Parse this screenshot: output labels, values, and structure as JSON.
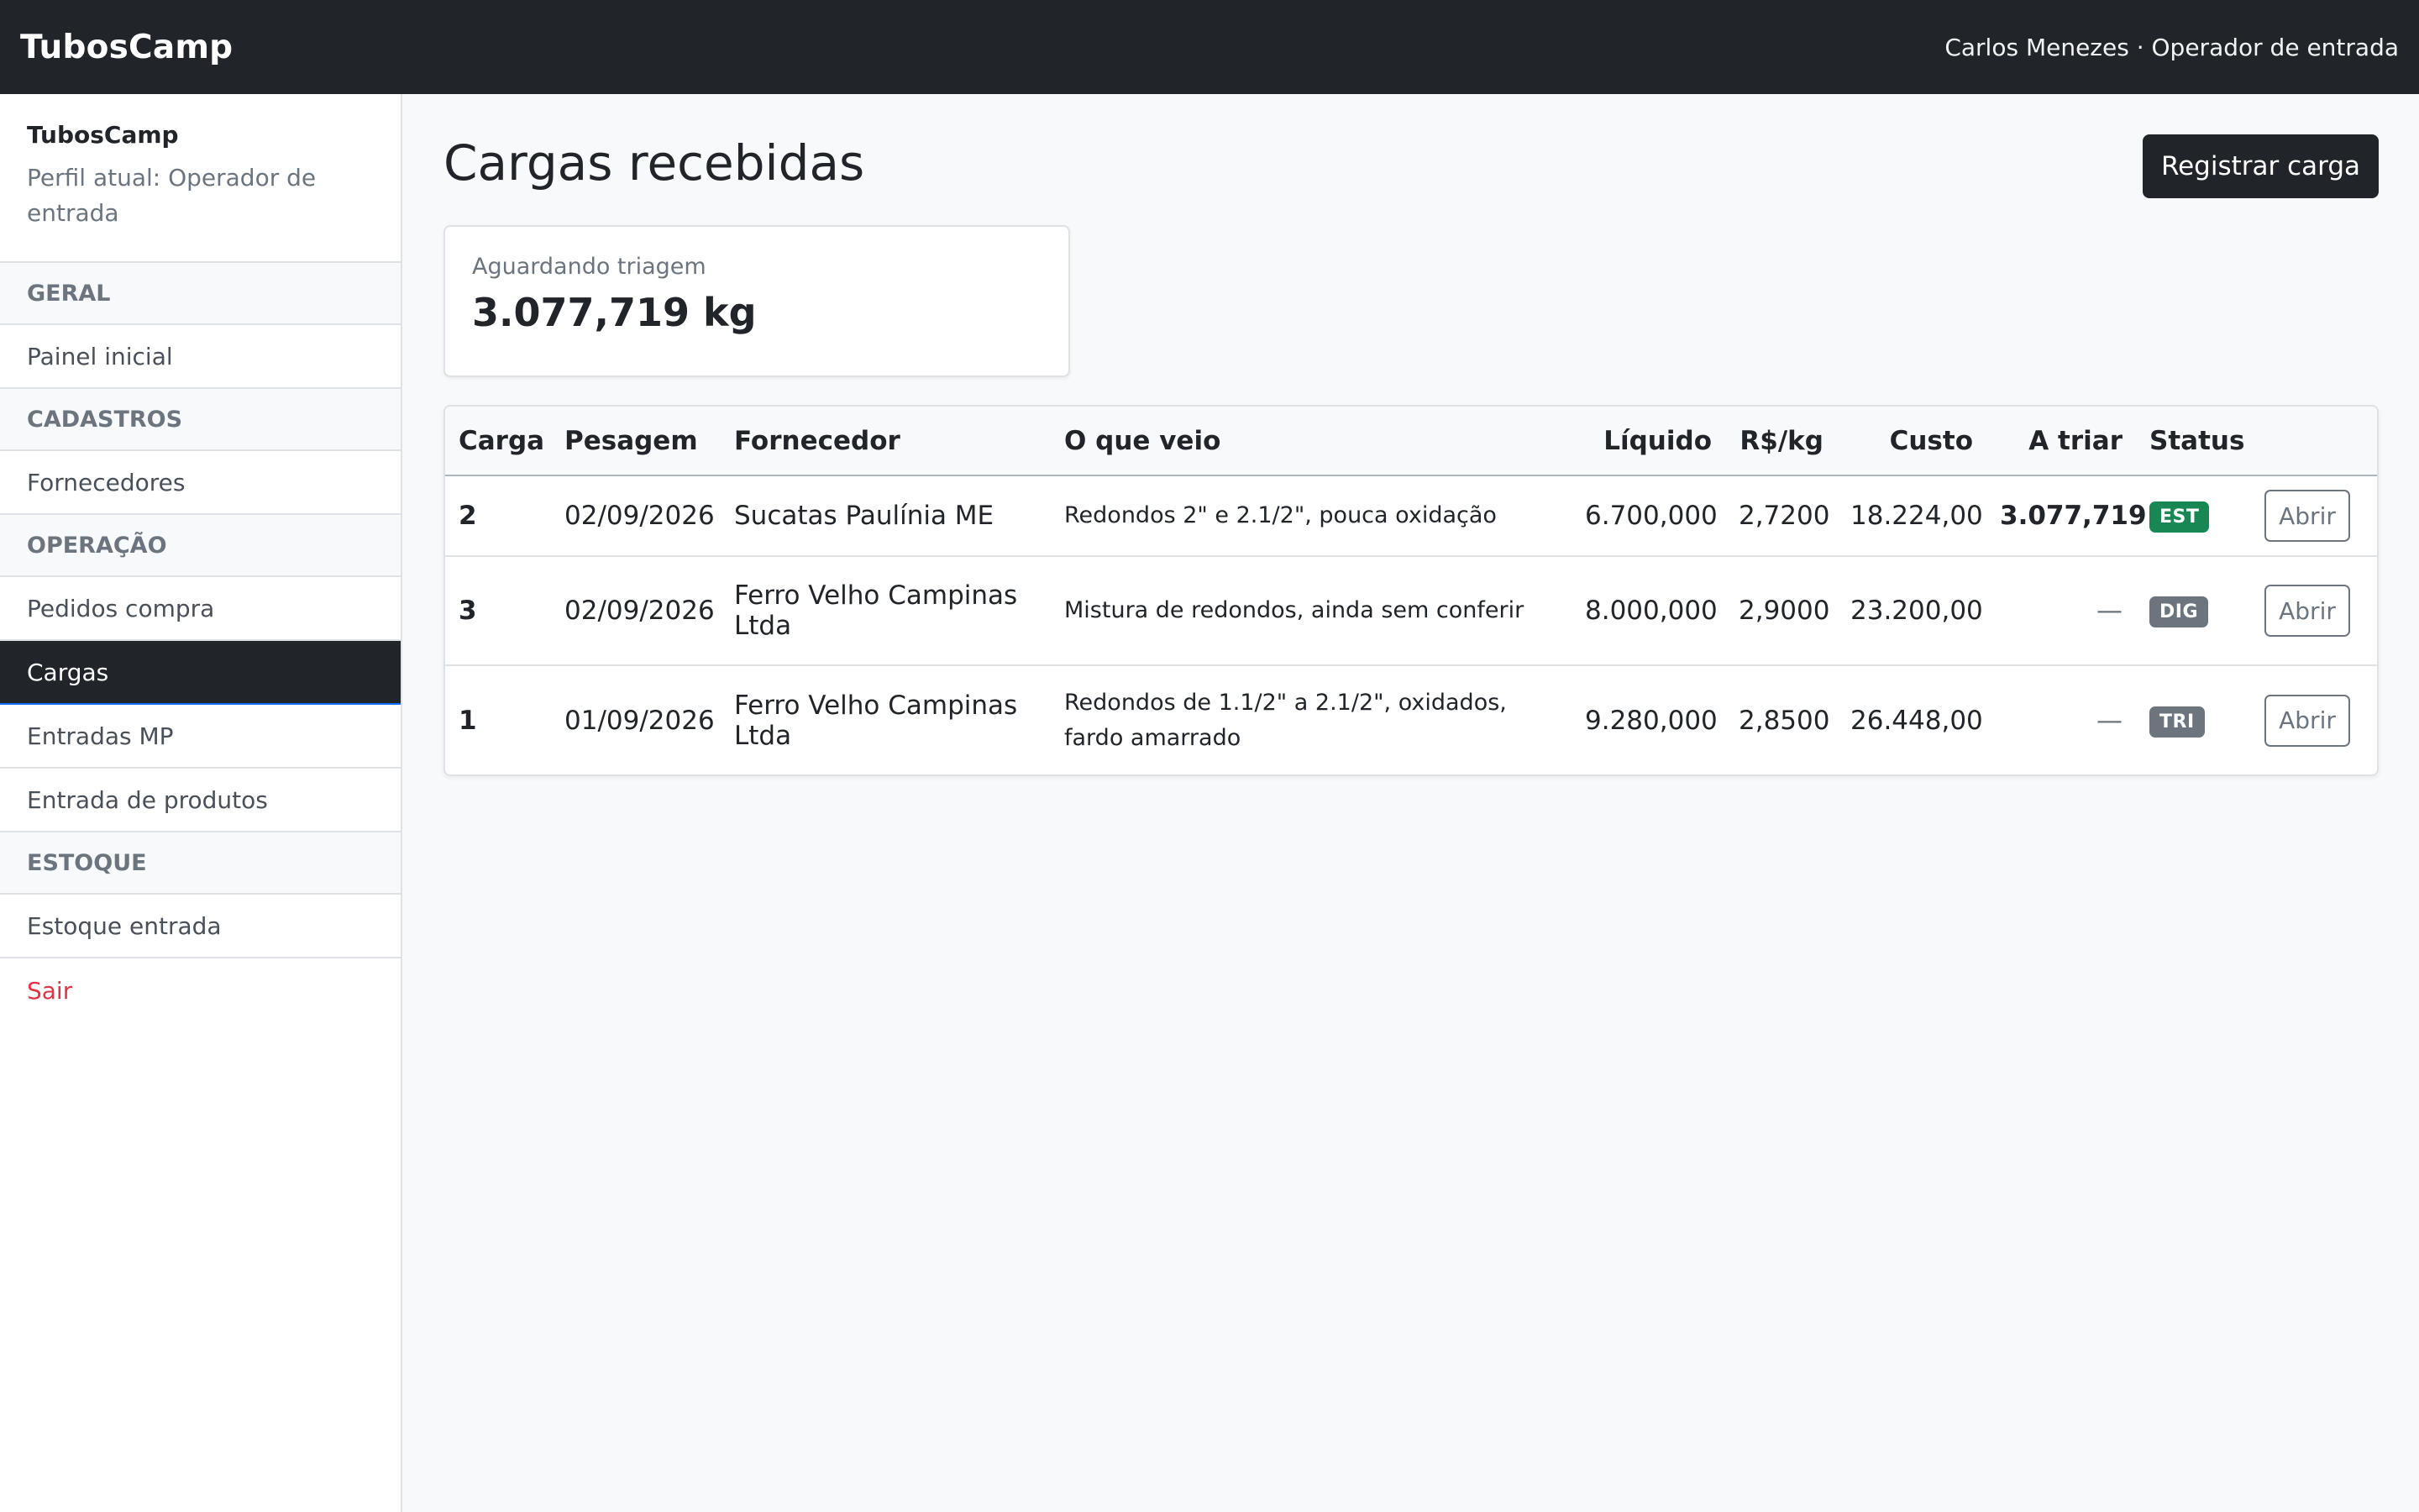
{
  "navbar": {
    "brand": "TubosCamp",
    "user": "Carlos Menezes · Operador de entrada"
  },
  "sidebar": {
    "app_name": "TubosCamp",
    "profile": "Perfil atual: Operador de entrada",
    "sections": [
      {
        "title": "GERAL",
        "items": [
          {
            "label": "Painel inicial",
            "active": false
          }
        ]
      },
      {
        "title": "CADASTROS",
        "items": [
          {
            "label": "Fornecedores",
            "active": false
          }
        ]
      },
      {
        "title": "OPERAÇÃO",
        "items": [
          {
            "label": "Pedidos compra",
            "active": false
          },
          {
            "label": "Cargas",
            "active": true
          },
          {
            "label": "Entradas MP",
            "active": false
          },
          {
            "label": "Entrada de produtos",
            "active": false
          }
        ]
      },
      {
        "title": "ESTOQUE",
        "items": [
          {
            "label": "Estoque entrada",
            "active": false
          }
        ]
      }
    ],
    "logout": "Sair"
  },
  "main": {
    "title": "Cargas recebidas",
    "register_button": "Registrar carga",
    "summary": {
      "label": "Aguardando triagem",
      "value": "3.077,719 kg"
    },
    "table": {
      "headers": {
        "carga": "Carga",
        "pesagem": "Pesagem",
        "fornecedor": "Fornecedor",
        "descricao": "O que veio",
        "liquido": "Líquido",
        "preco": "R$/kg",
        "custo": "Custo",
        "a_triar": "A triar",
        "status": "Status"
      },
      "rows": [
        {
          "carga": "2",
          "pesagem": "02/09/2026",
          "fornecedor": "Sucatas Paulínia ME",
          "descricao": "Redondos 2\" e 2.1/2\", pouca oxidação",
          "liquido": "6.700,000",
          "preco": "2,7200",
          "custo": "18.224,00",
          "a_triar": "3.077,719",
          "status": "EST",
          "status_color": "#198754",
          "action": "Abrir"
        },
        {
          "carga": "3",
          "pesagem": "02/09/2026",
          "fornecedor": "Ferro Velho Campinas Ltda",
          "descricao": "Mistura de redondos, ainda sem conferir",
          "liquido": "8.000,000",
          "preco": "2,9000",
          "custo": "23.200,00",
          "a_triar": "—",
          "status": "DIG",
          "status_color": "#6c757d",
          "action": "Abrir"
        },
        {
          "carga": "1",
          "pesagem": "01/09/2026",
          "fornecedor": "Ferro Velho Campinas Ltda",
          "descricao": "Redondos de 1.1/2\" a 2.1/2\", oxidados, fardo amarrado",
          "liquido": "9.280,000",
          "preco": "2,8500",
          "custo": "26.448,00",
          "a_triar": "—",
          "status": "TRI",
          "status_color": "#6c757d",
          "action": "Abrir"
        }
      ]
    }
  }
}
